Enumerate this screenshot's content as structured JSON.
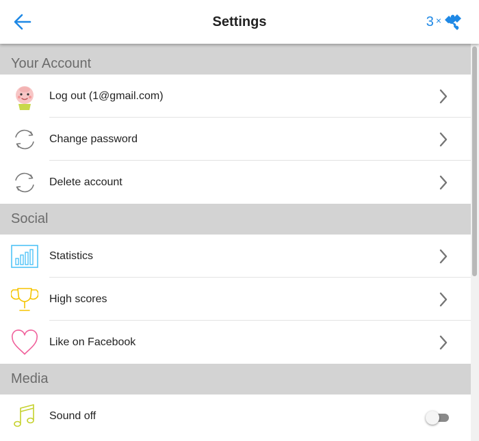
{
  "header": {
    "title": "Settings",
    "back_icon": "arrow-left-icon",
    "hint_count": "3",
    "hint_multiplier": "×",
    "hint_icon": "puzzle-piece-icon",
    "accent_color": "#1e88e5"
  },
  "sections": [
    {
      "title": "Your Account",
      "items": [
        {
          "label": "Log out (1@gmail.com)",
          "icon": "avatar-icon",
          "control": "chevron"
        },
        {
          "label": "Change password",
          "icon": "refresh-icon",
          "control": "chevron"
        },
        {
          "label": "Delete account",
          "icon": "refresh-icon",
          "control": "chevron"
        }
      ]
    },
    {
      "title": "Social",
      "items": [
        {
          "label": "Statistics",
          "icon": "bar-chart-icon",
          "control": "chevron"
        },
        {
          "label": "High scores",
          "icon": "trophy-icon",
          "control": "chevron"
        },
        {
          "label": "Like on Facebook",
          "icon": "heart-icon",
          "control": "chevron"
        }
      ]
    },
    {
      "title": "Media",
      "items": [
        {
          "label": "Sound off",
          "icon": "music-note-icon",
          "control": "toggle",
          "toggle_on": false
        }
      ]
    }
  ],
  "colors": {
    "section_header_bg": "#d3d3d3",
    "statistics_icon": "#4fc3f7",
    "trophy_icon": "#f5c400",
    "heart_icon": "#f0609b",
    "music_icon": "#c5d12c"
  }
}
